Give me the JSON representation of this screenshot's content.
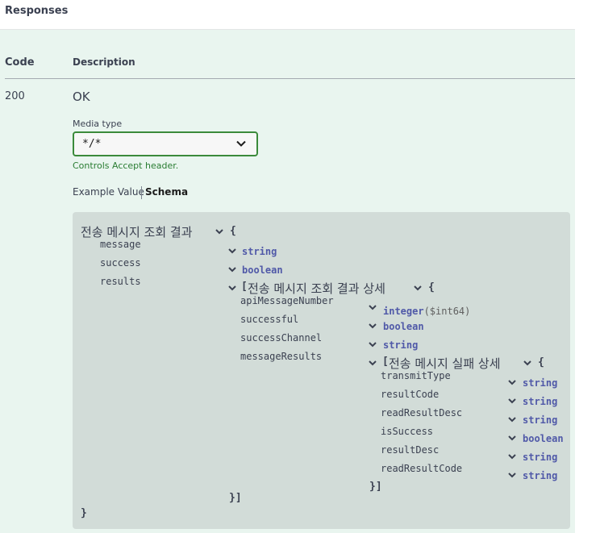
{
  "section": {
    "title": "Responses"
  },
  "table_header": {
    "code": "Code",
    "description": "Description"
  },
  "response": {
    "code": "200",
    "description": "OK",
    "media_type_label": "Media type",
    "media_type_value": "*/*",
    "accept_note": "Controls Accept header.",
    "tabs": {
      "example_value": "Example Value",
      "schema": "Schema"
    }
  },
  "schema": {
    "root_title": "전송 메시지 조회 결과",
    "root_open": "{",
    "root_close": "}",
    "fields": [
      {
        "name": "message",
        "type": "string"
      },
      {
        "name": "success",
        "type": "boolean"
      },
      {
        "name": "results",
        "open": "[",
        "title": "전송 메시지 조회 결과 상세",
        "brace": "{"
      }
    ],
    "results_fields": [
      {
        "name": "apiMessageNumber",
        "type": "integer",
        "format": "($int64)"
      },
      {
        "name": "successful",
        "type": "boolean"
      },
      {
        "name": "successChannel",
        "type": "string"
      },
      {
        "name": "messageResults",
        "open": "[",
        "title": "전송 메시지 실패 상세",
        "brace": "{"
      }
    ],
    "failure_fields": [
      {
        "name": "transmitType",
        "type": "string"
      },
      {
        "name": "resultCode",
        "type": "string"
      },
      {
        "name": "readResultDesc",
        "type": "string"
      },
      {
        "name": "isSuccess",
        "type": "boolean"
      },
      {
        "name": "resultDesc",
        "type": "string"
      },
      {
        "name": "readResultCode",
        "type": "string"
      }
    ],
    "failure_close": "}]",
    "results_close": "}]"
  },
  "icons": {
    "chevron": "chevron-down-icon"
  },
  "colors": {
    "panel": "#e9f5ef",
    "schema_bg": "#d2dcd8",
    "select_border": "#3b8a3b",
    "type": "#5059a8",
    "accept": "#2a7d33"
  }
}
